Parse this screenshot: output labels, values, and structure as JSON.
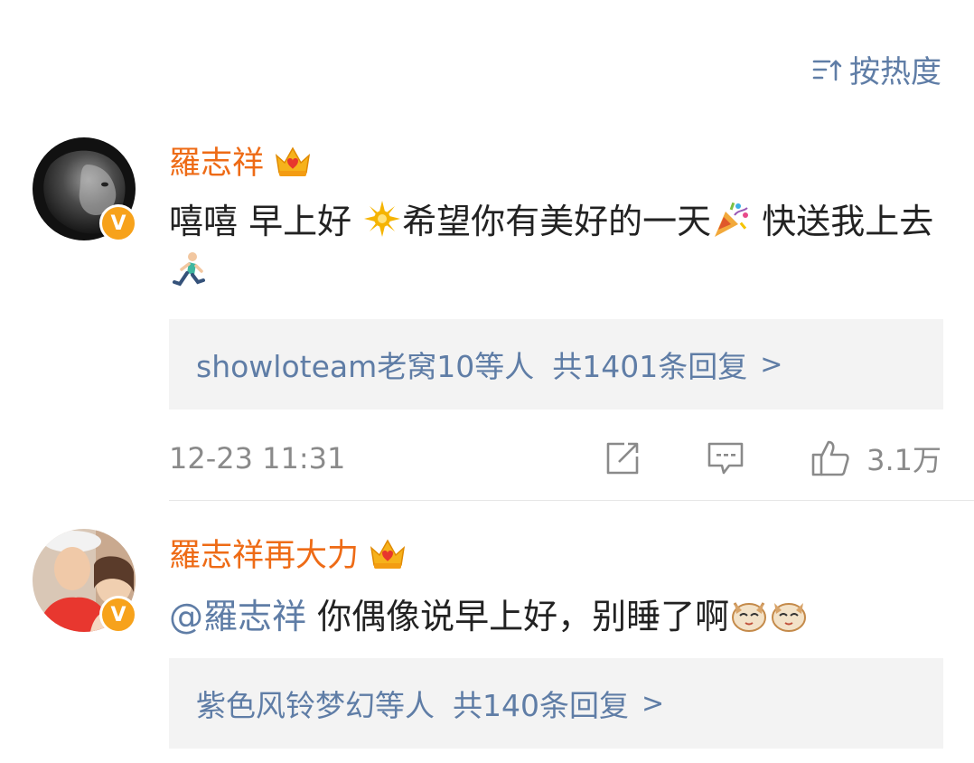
{
  "sort": {
    "label": "按热度",
    "icon": "sort-hot-icon"
  },
  "comments": [
    {
      "username": "羅志祥",
      "badge": "crown-vip-icon",
      "verified": "V",
      "text_parts": [
        "嘻嘻 早上好 ",
        "希望你有美好的一天",
        " 快送我上去"
      ],
      "emoji": [
        "sun-emoji",
        "party-popper-emoji",
        "runner-emoji"
      ],
      "replies": {
        "users": "showloteam老窝10等人",
        "count": "共1401条回复"
      },
      "time": "12-23 11:31",
      "likes": "3.1万"
    },
    {
      "username": "羅志祥再大力",
      "badge": "crown-vip-icon",
      "verified": "V",
      "mention": "@羅志祥",
      "text": " 你偶像说早上好，别睡了啊",
      "emoji": [
        "cat-face-emoji",
        "cat-face-emoji"
      ],
      "replies": {
        "users": "紫色风铃梦幻等人",
        "count": "共140条回复"
      }
    }
  ],
  "colors": {
    "accent_blue": "#5f7da6",
    "username_orange": "#ee6b16",
    "badge_gold": "#f7a21b",
    "text": "#222222",
    "muted": "#8a8a8a",
    "reply_bg": "#f3f3f3"
  }
}
